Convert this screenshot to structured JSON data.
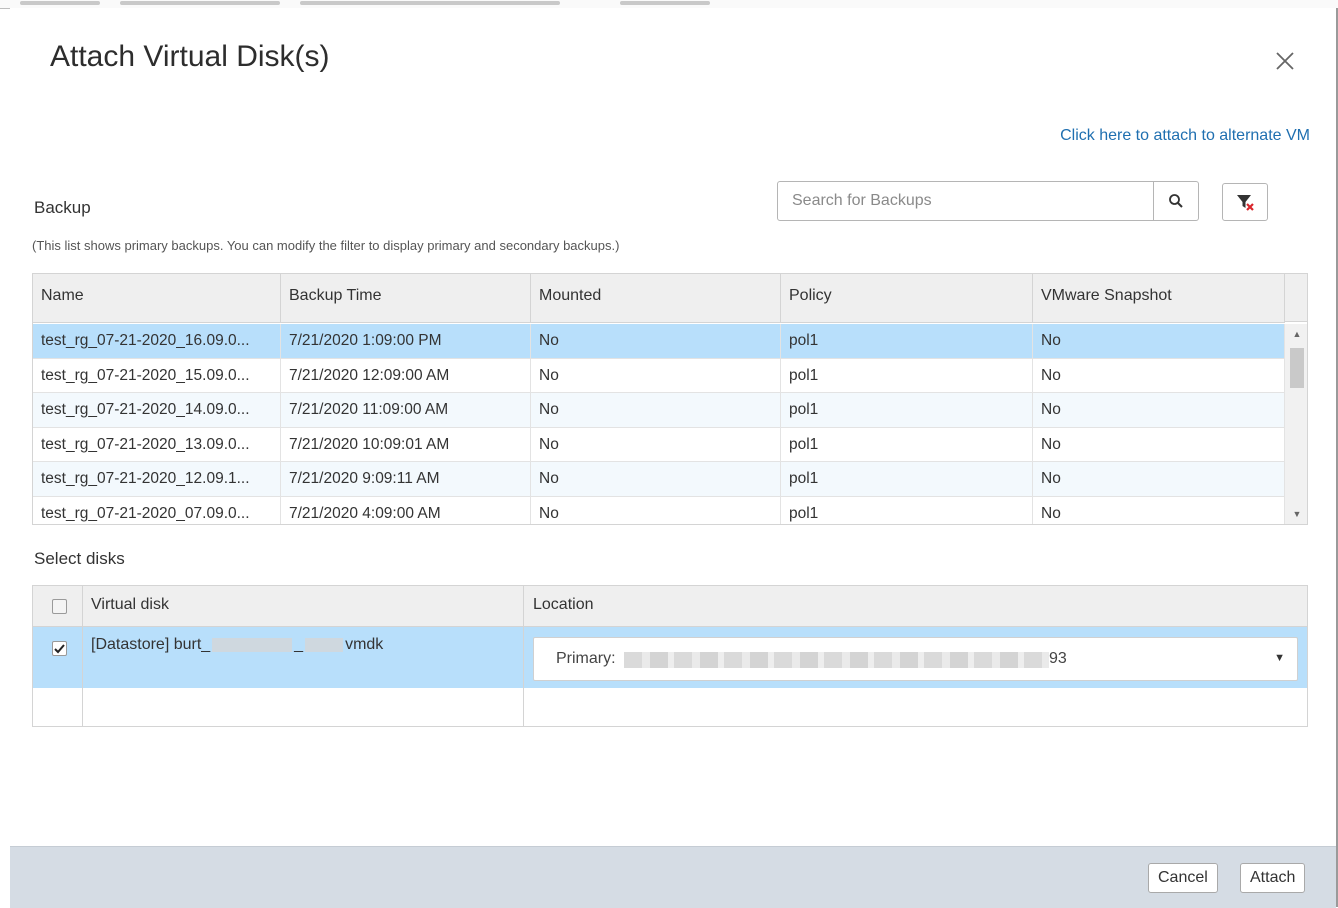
{
  "dialog": {
    "title": "Attach Virtual Disk(s)",
    "alternate_vm_link": "Click here to attach to alternate VM"
  },
  "backup": {
    "section_label": "Backup",
    "search_placeholder": "Search for Backups",
    "note": "(This list shows primary backups. You can modify the filter to display primary and secondary backups.)",
    "columns": [
      "Name",
      "Backup Time",
      "Mounted",
      "Policy",
      "VMware Snapshot"
    ],
    "rows": [
      [
        "test_rg_07-21-2020_16.09.0...",
        "7/21/2020 1:09:00 PM",
        "No",
        "pol1",
        "No"
      ],
      [
        "test_rg_07-21-2020_15.09.0...",
        "7/21/2020 12:09:00 AM",
        "No",
        "pol1",
        "No"
      ],
      [
        "test_rg_07-21-2020_14.09.0...",
        "7/21/2020 11:09:00 AM",
        "No",
        "pol1",
        "No"
      ],
      [
        "test_rg_07-21-2020_13.09.0...",
        "7/21/2020 10:09:01 AM",
        "No",
        "pol1",
        "No"
      ],
      [
        "test_rg_07-21-2020_12.09.1...",
        "7/21/2020 9:09:11 AM",
        "No",
        "pol1",
        "No"
      ],
      [
        "test_rg_07-21-2020_07.09.0...",
        "7/21/2020 4:09:00 AM",
        "No",
        "pol1",
        "No"
      ]
    ]
  },
  "disks": {
    "section_label": "Select disks",
    "col_virtual_disk": "Virtual disk",
    "col_location": "Location",
    "row": {
      "disk_prefix": "[Datastore] burt_",
      "disk_mid": "_",
      "disk_suffix": "vmdk",
      "location_prefix": "Primary:",
      "location_suffix": "93"
    }
  },
  "footer": {
    "cancel_label": "Cancel",
    "attach_label": "Attach"
  },
  "colors": {
    "selected_row": "#b8dffb",
    "link": "#1f6fb0",
    "footer_bg": "#d5dce4"
  }
}
